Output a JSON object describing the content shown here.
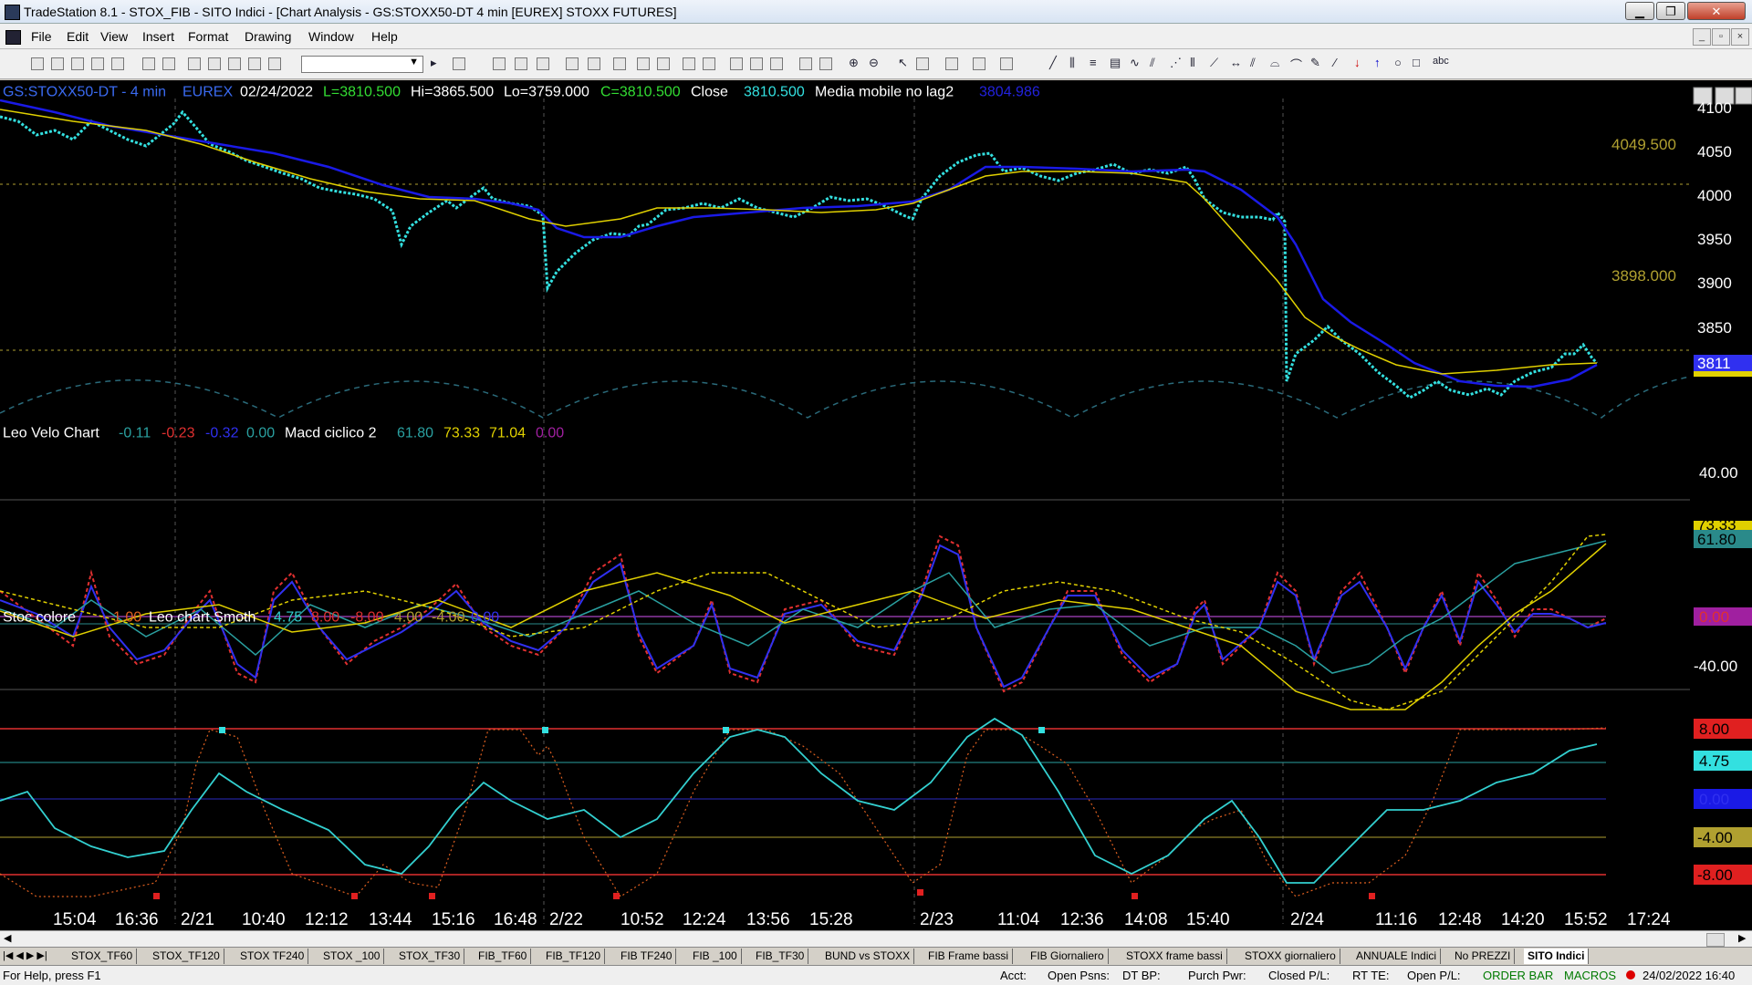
{
  "window": {
    "title": "TradeStation 8.1 - STOX_FIB - SITO Indici - [Chart Analysis - GS:STOXX50-DT  4 min  [EUREX] STOXX FUTURES]",
    "minimize": "▁",
    "maximize": "❐",
    "close": "✕"
  },
  "menu": [
    "File",
    "Edit",
    "View",
    "Insert",
    "Format",
    "Drawing",
    "Window",
    "Help"
  ],
  "chart": {
    "header": {
      "symbol": "GS:STOXX50-DT - 4 min",
      "exchange": "EUREX",
      "date": "02/24/2022",
      "last": "L=3810.500",
      "high": "Hi=3865.500",
      "low": "Lo=3759.000",
      "change": "C=3810.500",
      "close_label": "Close",
      "close_value": "3810.500",
      "study": "Media mobile no lag2",
      "study_value": "3804.986"
    },
    "price_axis": [
      "4100",
      "4050",
      "4000",
      "3950",
      "3900",
      "3850"
    ],
    "price_levels": [
      "4049.500",
      "3898.000"
    ],
    "last_price_tag": "3811",
    "pane2": {
      "labels": [
        "Leo Velo Chart",
        "-0.11",
        "-0.23",
        "-0.32",
        "0.00",
        "Macd ciclico 2",
        "61.80",
        "73.33",
        "71.04",
        "0.00"
      ],
      "axis": [
        "40.00",
        "-40.00"
      ],
      "tags": [
        "73.33",
        "61.80",
        "0.00"
      ]
    },
    "pane3": {
      "labels": [
        "Stoc colore",
        "1.00",
        "Leo chart Smoth",
        "4.75",
        "8.00",
        "-8.00",
        "4.00",
        "-4.00",
        "0.00"
      ],
      "tags": [
        "8.00",
        "4.75",
        "0.00",
        "-4.00",
        "-8.00"
      ]
    },
    "time_axis": [
      "15:04",
      "16:36",
      "2/21",
      "10:40",
      "12:12",
      "13:44",
      "15:16",
      "16:48",
      "2/22",
      "10:52",
      "12:24",
      "13:56",
      "15:28",
      "2/23",
      "11:04",
      "12:36",
      "14:08",
      "15:40",
      "2/24",
      "11:16",
      "12:48",
      "14:20",
      "15:52",
      "17:24"
    ]
  },
  "tabs": [
    "STOX_TF60",
    "STOX_TF120",
    "STOX TF240",
    "STOX _100",
    "STOX_TF30",
    "FIB_TF60",
    "FIB_TF120",
    "FIB TF240",
    "FIB _100",
    "FIB_TF30",
    "BUND vs STOXX",
    "FIB Frame bassi",
    "FIB Giornaliero",
    "STOXX frame bassi",
    "STOXX giornaliero",
    "ANNUALE Indici",
    "No PREZZI",
    "SITO Indici"
  ],
  "active_tab": "SITO Indici",
  "status": {
    "help": "For Help, press F1",
    "acct": "Acct:",
    "open_psns": "Open Psns:",
    "dt_bp": "DT BP:",
    "purch_pwr": "Purch Pwr:",
    "closed_pl": "Closed P/L:",
    "rt_te": "RT TE:",
    "open_pl": "Open P/L:",
    "order_bar": "ORDER BAR",
    "macros": "MACROS",
    "datetime": "24/02/2022 16:40"
  },
  "colors": {
    "price_bars": "#33e0e0",
    "ma_blue": "#1a1ae6",
    "ma_yellow": "#e0d000",
    "level_line": "#b0a030"
  }
}
